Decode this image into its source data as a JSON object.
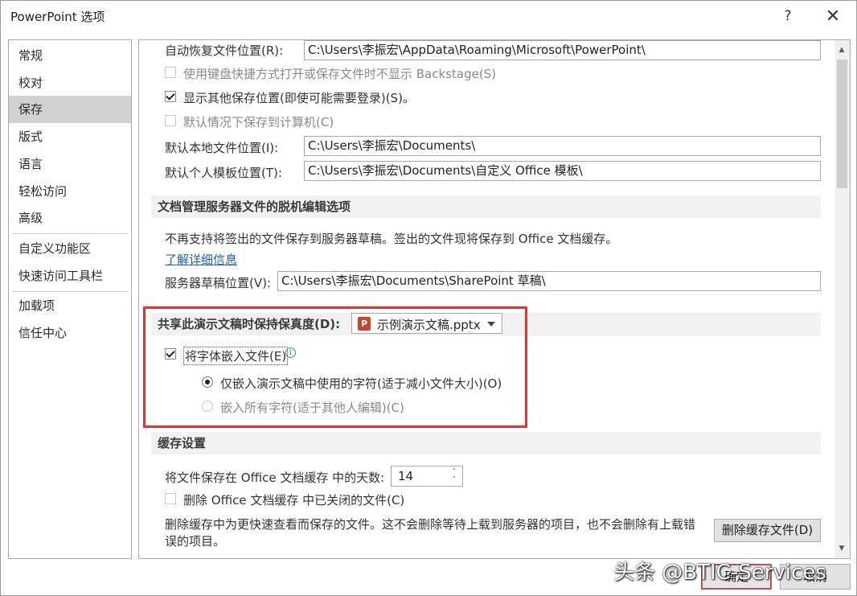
{
  "window": {
    "title": "PowerPoint 选项",
    "help_glyph": "?",
    "close_glyph": "✕"
  },
  "nav": {
    "items": [
      {
        "label": "常规"
      },
      {
        "label": "校对"
      },
      {
        "label": "保存",
        "active": true
      },
      {
        "label": "版式"
      },
      {
        "label": "语言"
      },
      {
        "label": "轻松访问"
      },
      {
        "label": "高级"
      },
      {
        "label": "自定义功能区"
      },
      {
        "label": "快速访问工具栏"
      },
      {
        "label": "加载项"
      },
      {
        "label": "信任中心"
      }
    ]
  },
  "save": {
    "autorecover_label": "自动恢复文件位置(R):",
    "autorecover_value": "C:\\Users\\李振宏\\AppData\\Roaming\\Microsoft\\PowerPoint\\",
    "backstage_label": "使用键盘快捷方式打开或保存文件时不显示 Backstage(S)",
    "backstage_checked": false,
    "show_other_locations_label": "显示其他保存位置(即使可能需要登录)(S)。",
    "show_other_locations_checked": true,
    "save_to_computer_label": "默认情况下保存到计算机(C)",
    "save_to_computer_checked": false,
    "local_file_label": "默认本地文件位置(I):",
    "local_file_value": "C:\\Users\\李振宏\\Documents\\",
    "template_label": "默认个人模板位置(T):",
    "template_value": "C:\\Users\\李振宏\\Documents\\自定义 Office 模板\\"
  },
  "offline": {
    "header": "文档管理服务器文件的脱机编辑选项",
    "notice": "不再支持将签出的文件保存到服务器草稿。签出的文件现将保存到 Office 文档缓存。",
    "learn_more": "了解详细信息",
    "drafts_label": "服务器草稿位置(V):",
    "drafts_value": "C:\\Users\\李振宏\\Documents\\SharePoint 草稿\\"
  },
  "fidelity": {
    "header": "共享此演示文稿时保持保真度(D):",
    "presentation": "示例演示文稿.pptx",
    "file_icon_letter": "P",
    "embed_fonts_label": "将字体嵌入文件(E)",
    "embed_fonts_checked": true,
    "info_glyph": "i",
    "radio_used_chars": "仅嵌入演示文稿中使用的字符(适于减小文件大小)(O)",
    "radio_all_chars": "嵌入所有字符(适于其他人编辑)(C)",
    "selected_option": "used_chars"
  },
  "cache": {
    "header": "缓存设置",
    "days_label": "将文件保存在 Office 文档缓存 中的天数:",
    "days_value": "14",
    "spin_up_glyph": "˄",
    "spin_down_glyph": "˅",
    "delete_closed_label": "删除 Office 文档缓存 中已关闭的文件(C)",
    "delete_closed_checked": false,
    "description_line1": "删除缓存中为更快速查看而保存的文件。这不会删除等待上载到服务器的项目，也不会删除有上载错",
    "description_line2": "误的项目。",
    "delete_button": "删除缓存文件(D)"
  },
  "scrollbar": {
    "up_glyph": "▲",
    "down_glyph": "▼"
  },
  "footer": {
    "ok": "确定",
    "cancel": "取消"
  },
  "watermark": "头条 @BTIC-Services",
  "colors": {
    "highlight_border": "#e23434",
    "nav_active": "#d2d2d2",
    "link": "#1f5fae",
    "section_header_bg": "#f1f1f1"
  }
}
